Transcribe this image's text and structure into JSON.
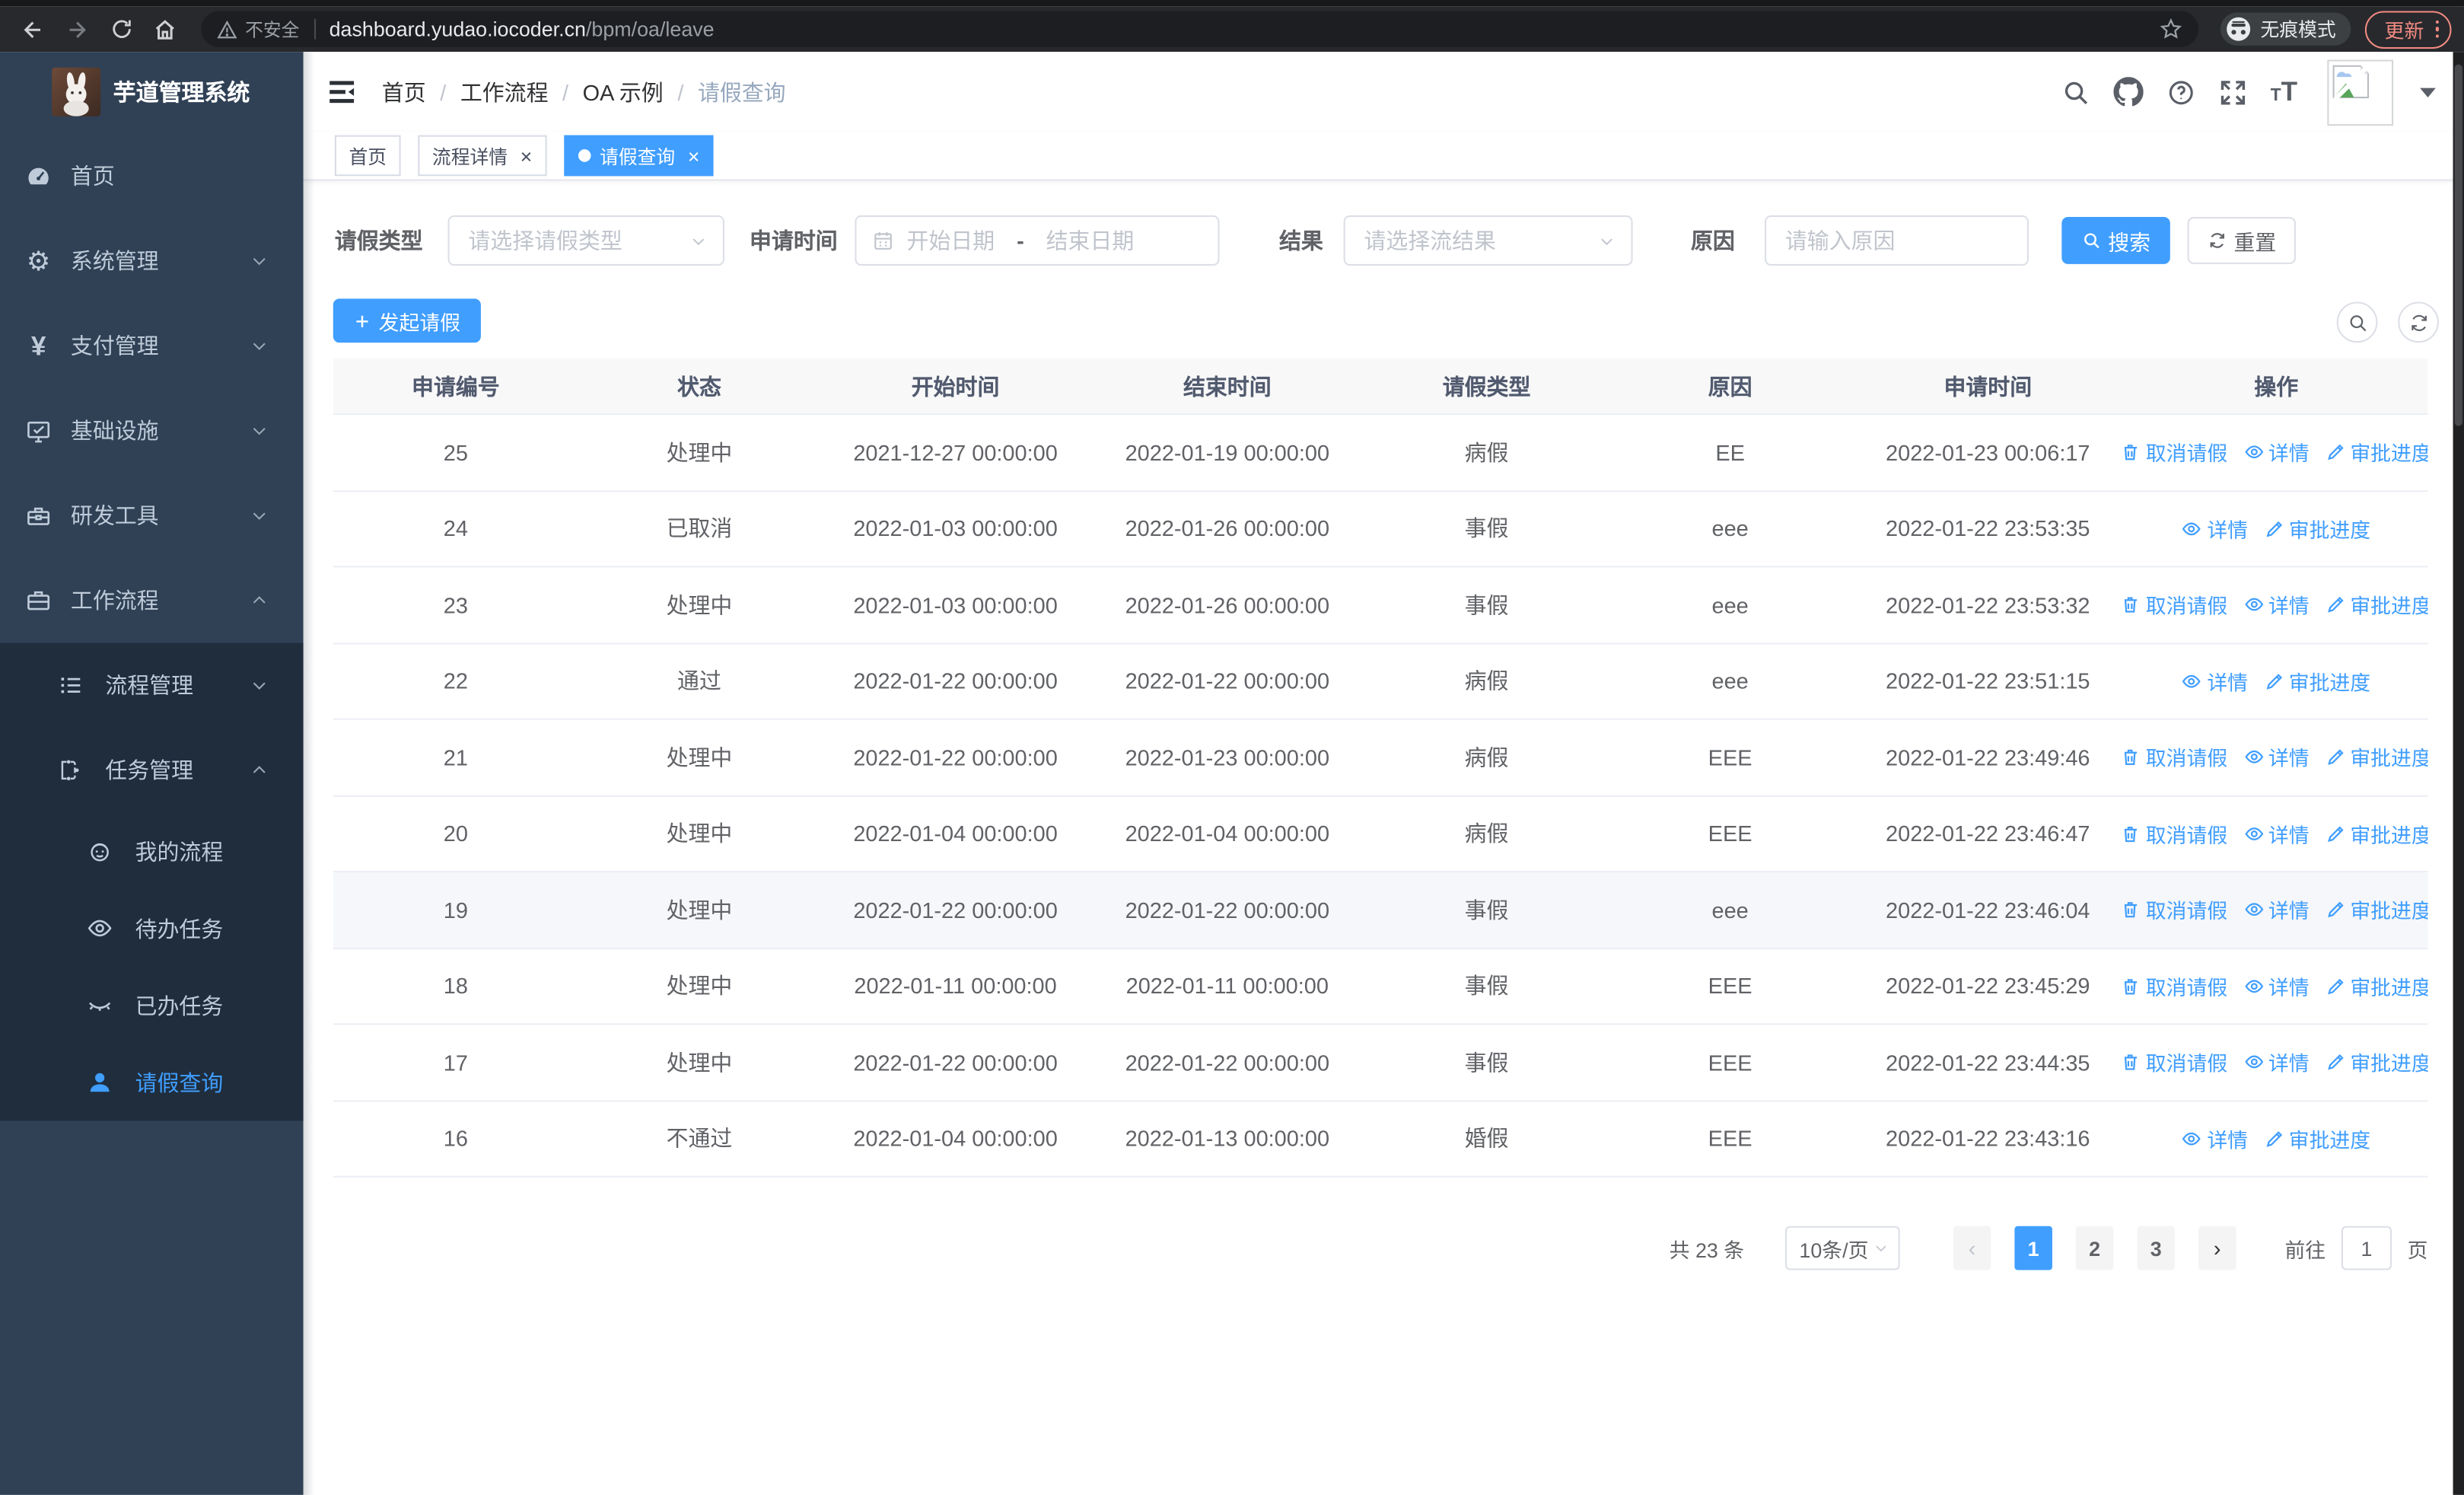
{
  "browser": {
    "security_label": "不安全",
    "url_host": "dashboard.yudao.iocoder.cn",
    "url_path": "/bpm/oa/leave",
    "incognito_label": "无痕模式",
    "update_label": "更新"
  },
  "sidebar": {
    "app_title": "芋道管理系统",
    "items": [
      {
        "label": "首页",
        "icon": "dashboard-icon",
        "level": 1,
        "chevron": "none",
        "active": false
      },
      {
        "label": "系统管理",
        "icon": "gear-icon",
        "level": 1,
        "chevron": "down",
        "active": false
      },
      {
        "label": "支付管理",
        "icon": "yen-icon",
        "level": 1,
        "chevron": "down",
        "active": false
      },
      {
        "label": "基础设施",
        "icon": "monitor-icon",
        "level": 1,
        "chevron": "down",
        "active": false
      },
      {
        "label": "研发工具",
        "icon": "toolbox-icon",
        "level": 1,
        "chevron": "down",
        "active": false
      },
      {
        "label": "工作流程",
        "icon": "briefcase-icon",
        "level": 1,
        "chevron": "up",
        "active": false
      },
      {
        "label": "流程管理",
        "icon": "list-icon",
        "level": 2,
        "chevron": "down",
        "active": false
      },
      {
        "label": "任务管理",
        "icon": "flow-icon",
        "level": 2,
        "chevron": "up",
        "active": false
      },
      {
        "label": "我的流程",
        "icon": "robot-icon",
        "level": 3,
        "chevron": "none",
        "active": false
      },
      {
        "label": "待办任务",
        "icon": "eye-icon",
        "level": 3,
        "chevron": "none",
        "active": false
      },
      {
        "label": "已办任务",
        "icon": "eye-closed-icon",
        "level": 3,
        "chevron": "none",
        "active": false
      },
      {
        "label": "请假查询",
        "icon": "user-icon",
        "level": 3,
        "chevron": "none",
        "active": true
      }
    ]
  },
  "header": {
    "breadcrumb": [
      "首页",
      "工作流程",
      "OA 示例",
      "请假查询"
    ],
    "breadcrumb_separator": "/"
  },
  "tabs": [
    {
      "label": "首页",
      "closable": false,
      "active": false
    },
    {
      "label": "流程详情",
      "closable": true,
      "active": false
    },
    {
      "label": "请假查询",
      "closable": true,
      "active": true
    }
  ],
  "tab_close_glyph": "×",
  "filters": {
    "type_label": "请假类型",
    "type_placeholder": "请选择请假类型",
    "time_label": "申请时间",
    "start_placeholder": "开始日期",
    "range_separator": "-",
    "end_placeholder": "结束日期",
    "result_label": "结果",
    "result_placeholder": "请选择流结果",
    "reason_label": "原因",
    "reason_placeholder": "请输入原因",
    "search_label": "搜索",
    "reset_label": "重置"
  },
  "toolbar": {
    "create_label": "发起请假"
  },
  "table": {
    "columns": [
      "申请编号",
      "状态",
      "开始时间",
      "结束时间",
      "请假类型",
      "原因",
      "申请时间",
      "操作"
    ],
    "action_labels": {
      "cancel": "取消请假",
      "detail": "详情",
      "progress": "审批进度"
    },
    "rows": [
      {
        "id": "25",
        "status": "处理中",
        "start": "2021-12-27 00:00:00",
        "end": "2022-01-19 00:00:00",
        "type": "病假",
        "reason": "EE",
        "applied": "2022-01-23 00:06:17",
        "actions": [
          "cancel",
          "detail",
          "progress"
        ],
        "highlight": false
      },
      {
        "id": "24",
        "status": "已取消",
        "start": "2022-01-03 00:00:00",
        "end": "2022-01-26 00:00:00",
        "type": "事假",
        "reason": "eee",
        "applied": "2022-01-22 23:53:35",
        "actions": [
          "detail",
          "progress"
        ],
        "highlight": false
      },
      {
        "id": "23",
        "status": "处理中",
        "start": "2022-01-03 00:00:00",
        "end": "2022-01-26 00:00:00",
        "type": "事假",
        "reason": "eee",
        "applied": "2022-01-22 23:53:32",
        "actions": [
          "cancel",
          "detail",
          "progress"
        ],
        "highlight": false
      },
      {
        "id": "22",
        "status": "通过",
        "start": "2022-01-22 00:00:00",
        "end": "2022-01-22 00:00:00",
        "type": "病假",
        "reason": "eee",
        "applied": "2022-01-22 23:51:15",
        "actions": [
          "detail",
          "progress"
        ],
        "highlight": false
      },
      {
        "id": "21",
        "status": "处理中",
        "start": "2022-01-22 00:00:00",
        "end": "2022-01-23 00:00:00",
        "type": "病假",
        "reason": "EEE",
        "applied": "2022-01-22 23:49:46",
        "actions": [
          "cancel",
          "detail",
          "progress"
        ],
        "highlight": false
      },
      {
        "id": "20",
        "status": "处理中",
        "start": "2022-01-04 00:00:00",
        "end": "2022-01-04 00:00:00",
        "type": "病假",
        "reason": "EEE",
        "applied": "2022-01-22 23:46:47",
        "actions": [
          "cancel",
          "detail",
          "progress"
        ],
        "highlight": false
      },
      {
        "id": "19",
        "status": "处理中",
        "start": "2022-01-22 00:00:00",
        "end": "2022-01-22 00:00:00",
        "type": "事假",
        "reason": "eee",
        "applied": "2022-01-22 23:46:04",
        "actions": [
          "cancel",
          "detail",
          "progress"
        ],
        "highlight": true
      },
      {
        "id": "18",
        "status": "处理中",
        "start": "2022-01-11 00:00:00",
        "end": "2022-01-11 00:00:00",
        "type": "事假",
        "reason": "EEE",
        "applied": "2022-01-22 23:45:29",
        "actions": [
          "cancel",
          "detail",
          "progress"
        ],
        "highlight": false
      },
      {
        "id": "17",
        "status": "处理中",
        "start": "2022-01-22 00:00:00",
        "end": "2022-01-22 00:00:00",
        "type": "事假",
        "reason": "EEE",
        "applied": "2022-01-22 23:44:35",
        "actions": [
          "cancel",
          "detail",
          "progress"
        ],
        "highlight": false
      },
      {
        "id": "16",
        "status": "不通过",
        "start": "2022-01-04 00:00:00",
        "end": "2022-01-13 00:00:00",
        "type": "婚假",
        "reason": "EEE",
        "applied": "2022-01-22 23:43:16",
        "actions": [
          "detail",
          "progress"
        ],
        "highlight": false
      }
    ]
  },
  "pagination": {
    "total_label": "共 23 条",
    "page_size_label": "10条/页",
    "prev_glyph": "‹",
    "next_glyph": "›",
    "pages": [
      "1",
      "2",
      "3"
    ],
    "active_page": "1",
    "goto_label": "前往",
    "goto_value": "1",
    "page_unit_label": "页"
  },
  "colors": {
    "accent": "#409eff",
    "sidebar_bg": "#304156",
    "submenu_bg": "#1f2d3d",
    "update_accent": "#f28b82"
  }
}
